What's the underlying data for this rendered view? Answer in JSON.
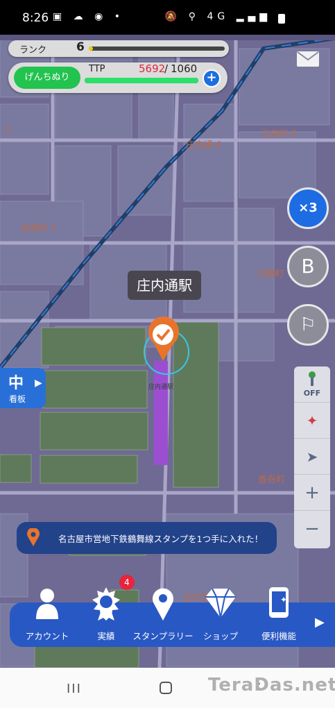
{
  "status_bar": {
    "time": "8:26",
    "left_icons": "▣ ☁ ◉ •",
    "right_icons": "🔕 ⚲ 4G ▂▄▆"
  },
  "map": {
    "labels": [
      "2",
      "江向町 6",
      "庄内通 4",
      "名塚町 1",
      "又穂町",
      "庄内通駅",
      "香呑町",
      "庄内通"
    ]
  },
  "hud": {
    "rank_label": "ランク",
    "rank_value": "6",
    "rank_progress": 0.03,
    "mode_button": "げんちぬり",
    "ttp_label": "TTP",
    "ttp_current": "5692",
    "ttp_slash": "/",
    "ttp_max": "1060",
    "ttp_progress": 1.0,
    "plus": "+"
  },
  "right_buttons": {
    "multiplier": "×3",
    "b": "B",
    "flag": "⚐"
  },
  "station": {
    "name": "庄内通駅"
  },
  "kanban": {
    "glyph": "中",
    "arrow": "▶",
    "label": "看板"
  },
  "tools": {
    "off_label": "OFF",
    "compass": "✦",
    "locate": "➤",
    "zoom_in": "+",
    "zoom_out": "−"
  },
  "notice": {
    "text": "名古屋市営地下鉄鶴舞線スタンプを1つ手に入れた！"
  },
  "bottom_nav": {
    "items": [
      {
        "label": "アカウント",
        "icon": "account-icon"
      },
      {
        "label": "実績",
        "icon": "medal-icon"
      },
      {
        "label": "スタンプラリー",
        "icon": "pin-icon"
      },
      {
        "label": "ショップ",
        "icon": "diamond-icon"
      },
      {
        "label": "便利機能",
        "icon": "phone-sparkle-icon"
      }
    ],
    "badge": "4",
    "next": "▶"
  },
  "android_nav": {
    "recent": "III",
    "back": "‹"
  },
  "watermark": "TeraDas.net",
  "colors": {
    "map_bg": "#6e6a94",
    "accent_blue": "#2858c4",
    "ttp_green": "#2de06a",
    "mode_green": "#22c34e",
    "station_orange": "#e8742c",
    "route_purple": "#9b4fd0"
  }
}
